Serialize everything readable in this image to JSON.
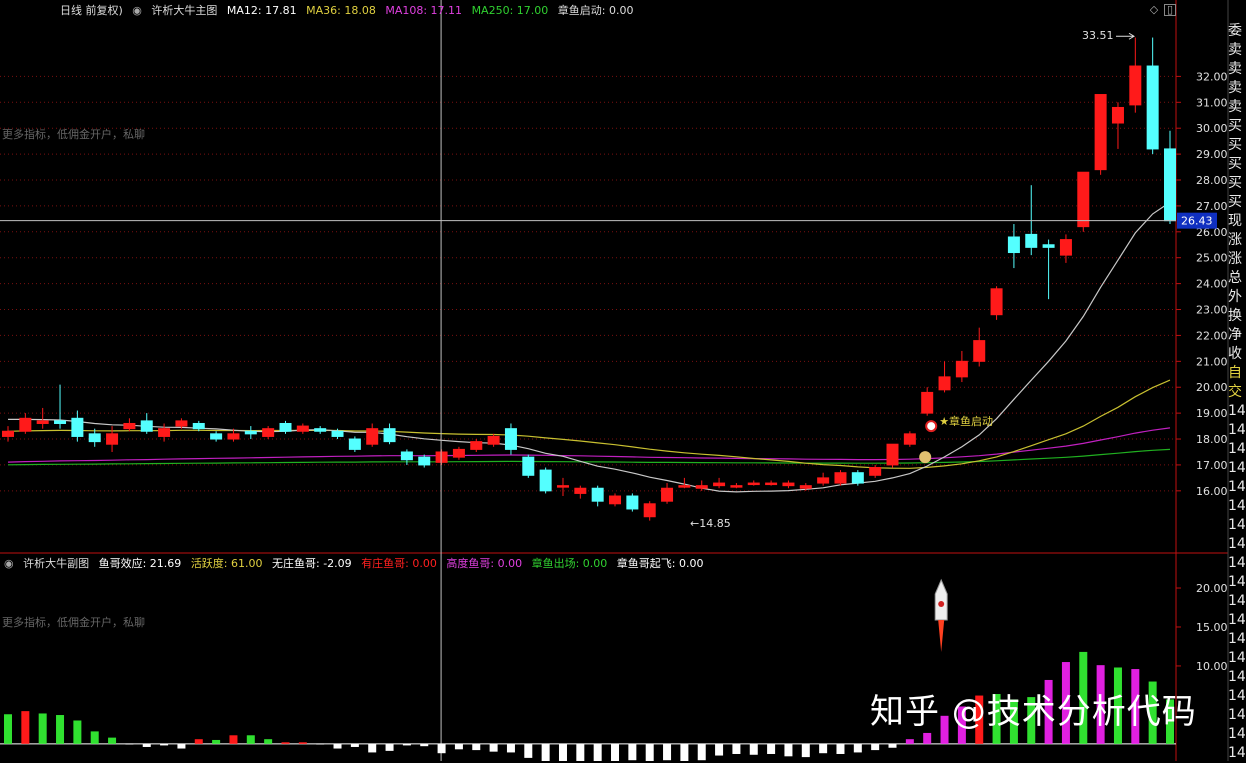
{
  "header": {
    "period_label": "日线 前复权)",
    "indicator_name": "许析大牛主图",
    "ma12": "MA12: 17.81",
    "ma36": "MA36: 18.08",
    "ma108": "MA108: 17.11",
    "ma250": "MA250: 17.00",
    "signal": "章鱼启动: 0.00"
  },
  "sub_header": {
    "indicator_name": "许析大牛副图",
    "v1": "鱼哥效应: 21.69",
    "v2": "活跃度: 61.00",
    "v3": "无庄鱼哥: -2.09",
    "v4": "有庄鱼哥: 0.00",
    "v5": "高度鱼哥: 0.00",
    "v6": "章鱼出场: 0.00",
    "v7": "章鱼哥起飞: 0.00"
  },
  "faint_text": "更多指标，低佣金开户，私聊",
  "right_panel": [
    "委",
    "卖",
    "卖",
    "卖",
    "卖",
    "买",
    "买",
    "买",
    "买",
    "买",
    "现",
    "涨",
    "涨",
    "总",
    "外",
    "换",
    "净",
    "收",
    "自",
    "交",
    "14",
    "14",
    "14",
    "14",
    "14",
    "14",
    "14",
    "14",
    "14",
    "14",
    "14",
    "14",
    "14",
    "14",
    "14",
    "14",
    "14",
    "14",
    "14"
  ],
  "watermark": "知乎 @技术分析代码",
  "colors": {
    "up": "#ff1a1a",
    "down": "#54ffff",
    "ma12": "#c8c8c8",
    "ma36": "#c8c030",
    "ma108": "#c020c0",
    "ma250": "#20b020",
    "cross": "#c0c0c0",
    "axis": "#c01010",
    "price_tag": "#1030c0"
  },
  "chart_data": {
    "type": "candlestick",
    "ylim": [
      13.6,
      34.1
    ],
    "y_ticks": [
      "16.00",
      "17.00",
      "18.00",
      "19.00",
      "20.00",
      "21.00",
      "22.00",
      "23.00",
      "24.00",
      "25.00",
      "26.00",
      "27.00",
      "28.00",
      "29.00",
      "30.00",
      "31.00",
      "32.00"
    ],
    "y_tick_values": [
      16,
      17,
      18,
      19,
      20,
      21,
      22,
      23,
      24,
      25,
      26,
      27,
      28,
      29,
      30,
      31,
      32
    ],
    "current_price": "26.43",
    "current_value": 26.43,
    "high_label": "33.51",
    "low_label": "14.85",
    "annotation": "★章鱼启动",
    "candles": [
      [
        18.1,
        18.3,
        17.9,
        18.5
      ],
      [
        18.3,
        18.8,
        18.2,
        19.0
      ],
      [
        18.6,
        18.7,
        18.4,
        19.2
      ],
      [
        18.7,
        18.6,
        18.4,
        20.1
      ],
      [
        18.8,
        18.1,
        17.9,
        19.1
      ],
      [
        18.2,
        17.9,
        17.7,
        18.4
      ],
      [
        17.8,
        18.2,
        17.5,
        18.5
      ],
      [
        18.4,
        18.6,
        18.3,
        18.8
      ],
      [
        18.7,
        18.3,
        18.2,
        19.0
      ],
      [
        18.1,
        18.4,
        17.9,
        18.6
      ],
      [
        18.5,
        18.7,
        18.4,
        18.8
      ],
      [
        18.6,
        18.4,
        18.3,
        18.7
      ],
      [
        18.2,
        18.0,
        17.9,
        18.3
      ],
      [
        18.0,
        18.2,
        17.9,
        18.4
      ],
      [
        18.3,
        18.2,
        18.0,
        18.5
      ],
      [
        18.1,
        18.4,
        18.0,
        18.5
      ],
      [
        18.6,
        18.3,
        18.2,
        18.7
      ],
      [
        18.3,
        18.5,
        18.2,
        18.6
      ],
      [
        18.4,
        18.3,
        18.2,
        18.5
      ],
      [
        18.3,
        18.1,
        18.0,
        18.4
      ],
      [
        18.0,
        17.6,
        17.5,
        18.1
      ],
      [
        17.8,
        18.4,
        17.7,
        18.6
      ],
      [
        18.4,
        17.9,
        17.8,
        18.6
      ],
      [
        17.5,
        17.2,
        17.0,
        17.6
      ],
      [
        17.3,
        17.0,
        16.9,
        17.4
      ],
      [
        17.1,
        17.5,
        17.0,
        17.6
      ],
      [
        17.3,
        17.6,
        17.2,
        17.7
      ],
      [
        17.6,
        17.9,
        17.5,
        18.0
      ],
      [
        17.8,
        18.1,
        17.7,
        18.2
      ],
      [
        18.4,
        17.6,
        17.4,
        18.6
      ],
      [
        17.3,
        16.6,
        16.5,
        17.4
      ],
      [
        16.8,
        16.0,
        15.9,
        16.9
      ],
      [
        16.2,
        16.2,
        15.8,
        16.5
      ],
      [
        15.9,
        16.1,
        15.7,
        16.2
      ],
      [
        16.1,
        15.6,
        15.4,
        16.2
      ],
      [
        15.5,
        15.8,
        15.4,
        15.9
      ],
      [
        15.8,
        15.3,
        15.2,
        15.9
      ],
      [
        15.0,
        15.5,
        14.85,
        15.6
      ],
      [
        15.6,
        16.1,
        15.5,
        16.3
      ],
      [
        16.2,
        16.2,
        16.1,
        16.5
      ],
      [
        16.1,
        16.2,
        16.0,
        16.4
      ],
      [
        16.2,
        16.3,
        16.1,
        16.5
      ],
      [
        16.2,
        16.2,
        16.1,
        16.3
      ],
      [
        16.3,
        16.3,
        16.2,
        16.4
      ],
      [
        16.3,
        16.3,
        16.2,
        16.4
      ],
      [
        16.2,
        16.3,
        16.1,
        16.4
      ],
      [
        16.1,
        16.2,
        16.0,
        16.3
      ],
      [
        16.3,
        16.5,
        16.2,
        16.7
      ],
      [
        16.3,
        16.7,
        16.2,
        16.8
      ],
      [
        16.7,
        16.3,
        16.2,
        16.8
      ],
      [
        16.6,
        16.9,
        16.5,
        17.0
      ],
      [
        17.0,
        17.8,
        16.9,
        17.8
      ],
      [
        17.8,
        18.2,
        17.7,
        18.3
      ],
      [
        19.0,
        19.8,
        18.9,
        20.0
      ],
      [
        19.9,
        20.4,
        19.8,
        21.0
      ],
      [
        20.4,
        21.0,
        20.2,
        21.4
      ],
      [
        21.0,
        21.8,
        20.8,
        22.3
      ],
      [
        22.8,
        23.8,
        22.6,
        23.9
      ],
      [
        25.8,
        25.2,
        24.6,
        26.3
      ],
      [
        25.9,
        25.4,
        25.1,
        27.8
      ],
      [
        25.5,
        25.4,
        23.4,
        25.7
      ],
      [
        25.1,
        25.7,
        24.8,
        25.9
      ],
      [
        26.2,
        28.3,
        26.0,
        28.3
      ],
      [
        28.4,
        31.3,
        28.2,
        31.3
      ],
      [
        30.2,
        30.8,
        29.2,
        31.0
      ],
      [
        30.9,
        32.4,
        30.6,
        33.5
      ],
      [
        32.4,
        29.2,
        29.0,
        33.5
      ],
      [
        29.2,
        26.43,
        26.3,
        29.9
      ]
    ],
    "sub_ylim": [
      -2.2,
      21.8
    ],
    "sub_y_ticks": [
      "20.00",
      "15.00",
      "10.00"
    ],
    "sub_y_tick_values": [
      20,
      15,
      10
    ],
    "sub_bars": [
      [
        3.8,
        "g"
      ],
      [
        4.2,
        "r"
      ],
      [
        3.9,
        "g"
      ],
      [
        3.7,
        "g"
      ],
      [
        3.0,
        "g"
      ],
      [
        1.6,
        "g"
      ],
      [
        0.8,
        "g"
      ],
      [
        0.05,
        "w"
      ],
      [
        -0.4,
        "w"
      ],
      [
        -0.2,
        "w"
      ],
      [
        -0.6,
        "w"
      ],
      [
        0.6,
        "r"
      ],
      [
        0.5,
        "g"
      ],
      [
        1.1,
        "r"
      ],
      [
        1.1,
        "g"
      ],
      [
        0.6,
        "g"
      ],
      [
        0.2,
        "r"
      ],
      [
        0.2,
        "r"
      ],
      [
        0.05,
        "w"
      ],
      [
        -0.6,
        "w"
      ],
      [
        -0.4,
        "w"
      ],
      [
        -1.1,
        "w"
      ],
      [
        -0.9,
        "w"
      ],
      [
        -0.2,
        "w"
      ],
      [
        -0.3,
        "w"
      ],
      [
        -1.2,
        "w"
      ],
      [
        -0.7,
        "w"
      ],
      [
        -0.8,
        "w"
      ],
      [
        -1.0,
        "w"
      ],
      [
        -1.1,
        "w"
      ],
      [
        -1.8,
        "w"
      ],
      [
        -3.1,
        "w"
      ],
      [
        -4.5,
        "w"
      ],
      [
        -3.7,
        "w"
      ],
      [
        -3.1,
        "w"
      ],
      [
        -2.8,
        "w"
      ],
      [
        -2.1,
        "w"
      ],
      [
        -2.5,
        "w"
      ],
      [
        -2.1,
        "w"
      ],
      [
        -2.4,
        "w"
      ],
      [
        -2.1,
        "w"
      ],
      [
        -1.5,
        "w"
      ],
      [
        -1.3,
        "w"
      ],
      [
        -1.4,
        "w"
      ],
      [
        -1.3,
        "w"
      ],
      [
        -1.6,
        "w"
      ],
      [
        -1.7,
        "w"
      ],
      [
        -1.2,
        "w"
      ],
      [
        -1.3,
        "w"
      ],
      [
        -1.1,
        "w"
      ],
      [
        -0.8,
        "w"
      ],
      [
        -0.5,
        "w"
      ],
      [
        0.6,
        "m"
      ],
      [
        1.4,
        "m"
      ],
      [
        3.6,
        "m"
      ],
      [
        4.8,
        "m"
      ],
      [
        6.2,
        "r"
      ],
      [
        6.4,
        "g"
      ],
      [
        5.7,
        "g"
      ],
      [
        6.0,
        "g"
      ],
      [
        8.2,
        "m"
      ],
      [
        10.5,
        "m"
      ],
      [
        11.8,
        "g"
      ],
      [
        10.1,
        "m"
      ],
      [
        9.8,
        "g"
      ],
      [
        9.6,
        "m"
      ],
      [
        8.0,
        "g"
      ],
      [
        5.7,
        "g"
      ]
    ],
    "rocket_index": 53
  }
}
